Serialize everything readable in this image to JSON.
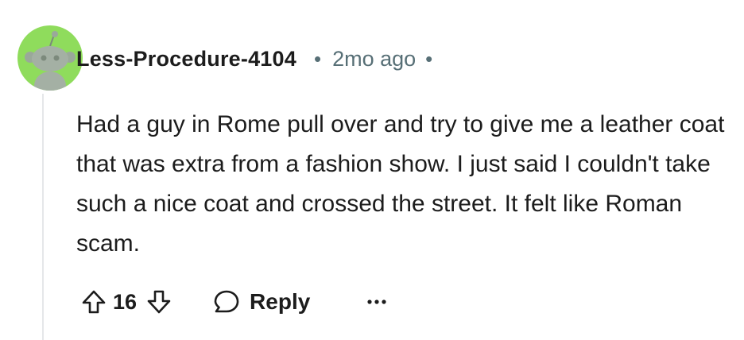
{
  "comment": {
    "username": "Less-Procedure-4104",
    "separator": "•",
    "timestamp": "2mo ago",
    "body": "Had a guy in Rome pull over and try to give me a leather coat that was extra from a fashion show. I just said I couldn't take such a nice coat and crossed the street. It felt like Roman scam.",
    "score": "16",
    "reply_label": "Reply"
  },
  "icons": {
    "avatar": "snoo-avatar",
    "upvote": "upvote-arrow-icon",
    "downvote": "downvote-arrow-icon",
    "reply": "speech-bubble-icon",
    "more": "ellipsis-icon"
  },
  "colors": {
    "avatar_background": "#8fdc5c",
    "muted_text": "#576f76",
    "primary_text": "#1c1c1c",
    "thread_line": "#e5e7e9"
  }
}
